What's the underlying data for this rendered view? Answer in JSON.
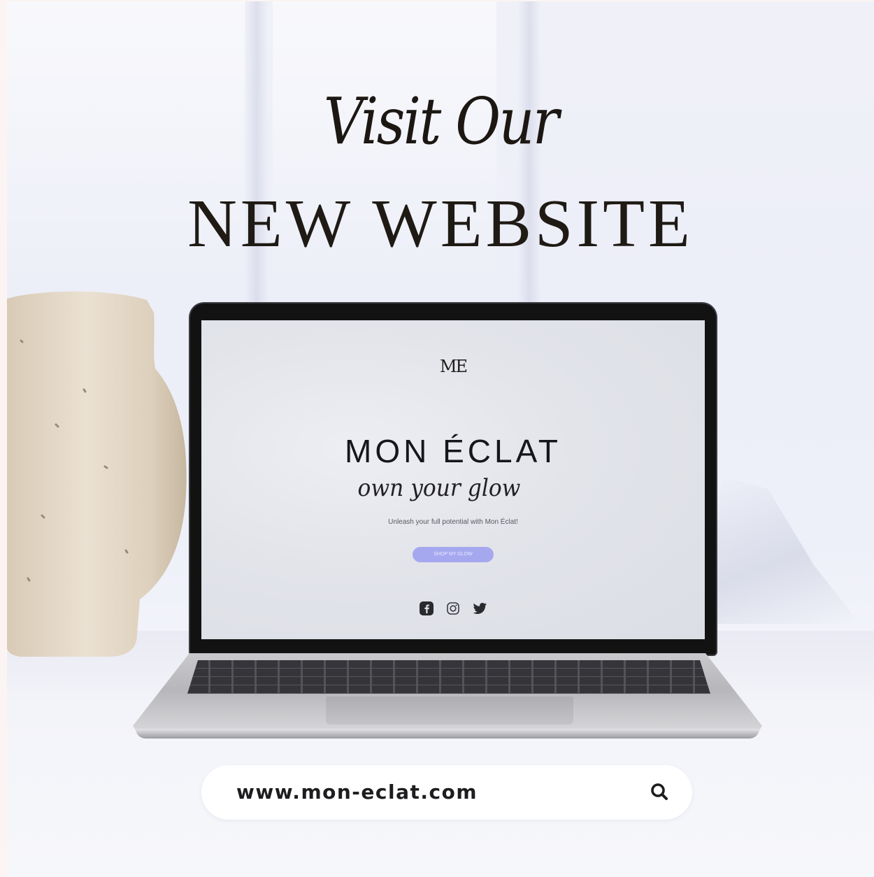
{
  "headline": {
    "script_line": "Visit Our",
    "caps_line": "NEW WEBSITE"
  },
  "laptop_screen": {
    "logo": "ME",
    "brand": "MON ÉCLAT",
    "tagline": "own your glow",
    "subtext": "Unleash your full potential with Mon Éclat!",
    "cta_label": "SHOP MY GLOW",
    "social_icons": [
      "facebook-icon",
      "instagram-icon",
      "twitter-icon"
    ]
  },
  "url_bar": {
    "url": "www.mon-eclat.com",
    "icon": "search-icon"
  },
  "colors": {
    "background": "#eef0f8",
    "text_dark": "#1c1712",
    "cta_lavender": "#a6a8ef",
    "vase_beige": "#e2d6c5"
  }
}
